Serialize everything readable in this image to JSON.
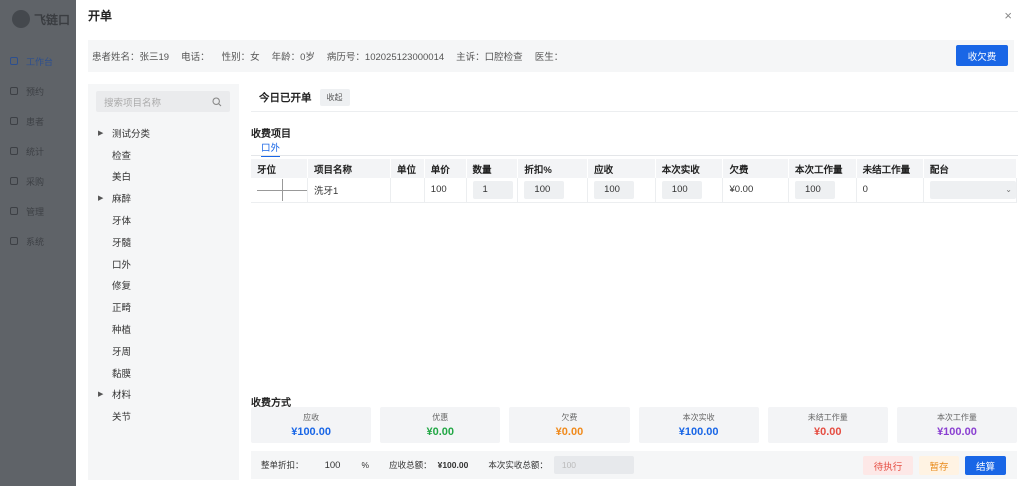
{
  "background": {
    "logo_text": "飞链口",
    "nav": [
      {
        "label": "工作台",
        "active": true
      },
      {
        "label": "预约",
        "active": false
      },
      {
        "label": "患者",
        "active": false
      },
      {
        "label": "统计",
        "active": false
      },
      {
        "label": "采购",
        "active": false
      },
      {
        "label": "管理",
        "active": false
      },
      {
        "label": "系统",
        "active": false
      }
    ]
  },
  "modal": {
    "title": "开单",
    "close_icon": "×"
  },
  "patient": {
    "name": "患者姓名：张三19",
    "phone": "电话：",
    "gender": "性别：女",
    "age": "年龄：0岁",
    "record_no": "病历号：102025123000014",
    "complaint": "主诉：口腔检查",
    "doctor": "医生：",
    "charge_button": "收欠费"
  },
  "left_panel": {
    "search_placeholder": "搜索项目名称",
    "tree": [
      {
        "label": "测试分类",
        "expandable": true
      },
      {
        "label": "检查",
        "expandable": false
      },
      {
        "label": "美白",
        "expandable": false
      },
      {
        "label": "麻醉",
        "expandable": true
      },
      {
        "label": "牙体",
        "expandable": false
      },
      {
        "label": "牙髓",
        "expandable": false
      },
      {
        "label": "口外",
        "expandable": false
      },
      {
        "label": "修复",
        "expandable": false
      },
      {
        "label": "正畸",
        "expandable": false
      },
      {
        "label": "种植",
        "expandable": false
      },
      {
        "label": "牙周",
        "expandable": false
      },
      {
        "label": "黏膜",
        "expandable": false
      },
      {
        "label": "材料",
        "expandable": true
      },
      {
        "label": "关节",
        "expandable": false
      }
    ]
  },
  "main": {
    "today_label": "今日已开单",
    "collapse_label": "收起",
    "fee_section_title": "收费项目",
    "active_tab": "口外",
    "columns": [
      "牙位",
      "项目名称",
      "单位",
      "单价",
      "数量",
      "折扣%",
      "应收",
      "本次实收",
      "欠费",
      "本次工作量",
      "未结工作量",
      "配台"
    ],
    "rows": [
      {
        "tooth": "",
        "name": "洗牙1",
        "unit": "",
        "price": "100",
        "qty": "1",
        "discount": "100",
        "receivable": "100",
        "actual": "100",
        "arrears": "¥0.00",
        "workload": "100",
        "unsettled": "0",
        "assist": ""
      }
    ],
    "payment_title": "收费方式",
    "payment_cards": [
      {
        "label": "应收",
        "value": "¥100.00",
        "color": "#1966e6"
      },
      {
        "label": "优惠",
        "value": "¥0.00",
        "color": "#22a745"
      },
      {
        "label": "欠费",
        "value": "¥0.00",
        "color": "#f08a1c"
      },
      {
        "label": "本次实收",
        "value": "¥100.00",
        "color": "#1966e6"
      },
      {
        "label": "未结工作量",
        "value": "¥0.00",
        "color": "#e54d42"
      },
      {
        "label": "本次工作量",
        "value": "¥100.00",
        "color": "#8a3fd1"
      }
    ],
    "footer": {
      "discount_label": "整单折扣：",
      "discount_value": "100",
      "discount_unit": "%",
      "total_label": "应收总额：",
      "total_value": "¥100.00",
      "actual_label": "本次实收总额：",
      "actual_placeholder": "100",
      "pending_button": "待执行",
      "save_button": "暂存",
      "settle_button": "结算"
    }
  }
}
